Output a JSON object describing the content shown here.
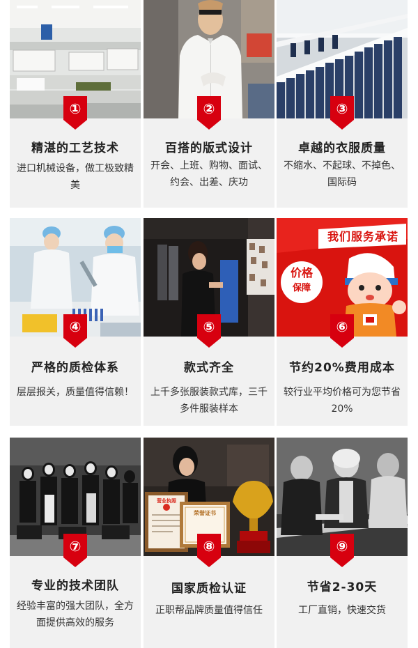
{
  "accent_color": "#d7000f",
  "cards": [
    {
      "num": "①",
      "title": "精湛的工艺技术",
      "desc": "进口机械设备，做工极致精美",
      "photo": "sewing-factory-photo"
    },
    {
      "num": "②",
      "title": "百搭的版式设计",
      "desc": "开会、上班、购物、面试、约会、出差、庆功",
      "photo": "model-white-shirt-photo"
    },
    {
      "num": "③",
      "title": "卓越的衣服质量",
      "desc": "不缩水、不起球、不掉色、国际码",
      "photo": "garment-rack-photo"
    },
    {
      "num": "④",
      "title": "严格的质检体系",
      "desc": "层层报关，质量值得信赖！",
      "photo": "lab-inspection-photo"
    },
    {
      "num": "⑤",
      "title": "款式齐全",
      "desc": "上千多张服装款式库，三千多件服装样本",
      "photo": "showroom-photo"
    },
    {
      "num": "⑥",
      "title": "节约20%费用成本",
      "desc": "较行业平均价格可为您节省20%",
      "photo": "price-promise-cartoon"
    },
    {
      "num": "⑦",
      "title": "专业的技术团队",
      "desc": "经验丰富的强大团队，全方面提供高效的服务",
      "photo": "team-photo"
    },
    {
      "num": "⑧",
      "title": "国家质检认证",
      "desc": "正职帮品牌质量值得信任",
      "photo": "certificate-trophy-photo"
    },
    {
      "num": "⑨",
      "title": "节省2-30天",
      "desc": "工厂直销，快速交货",
      "photo": "tailoring-photo"
    }
  ],
  "cartoon": {
    "banner": "我们服务承诺",
    "bubble_top": "价格",
    "bubble_bottom": "保障"
  },
  "certificates": {
    "left": "营业执照",
    "right": "荣誉证书"
  }
}
